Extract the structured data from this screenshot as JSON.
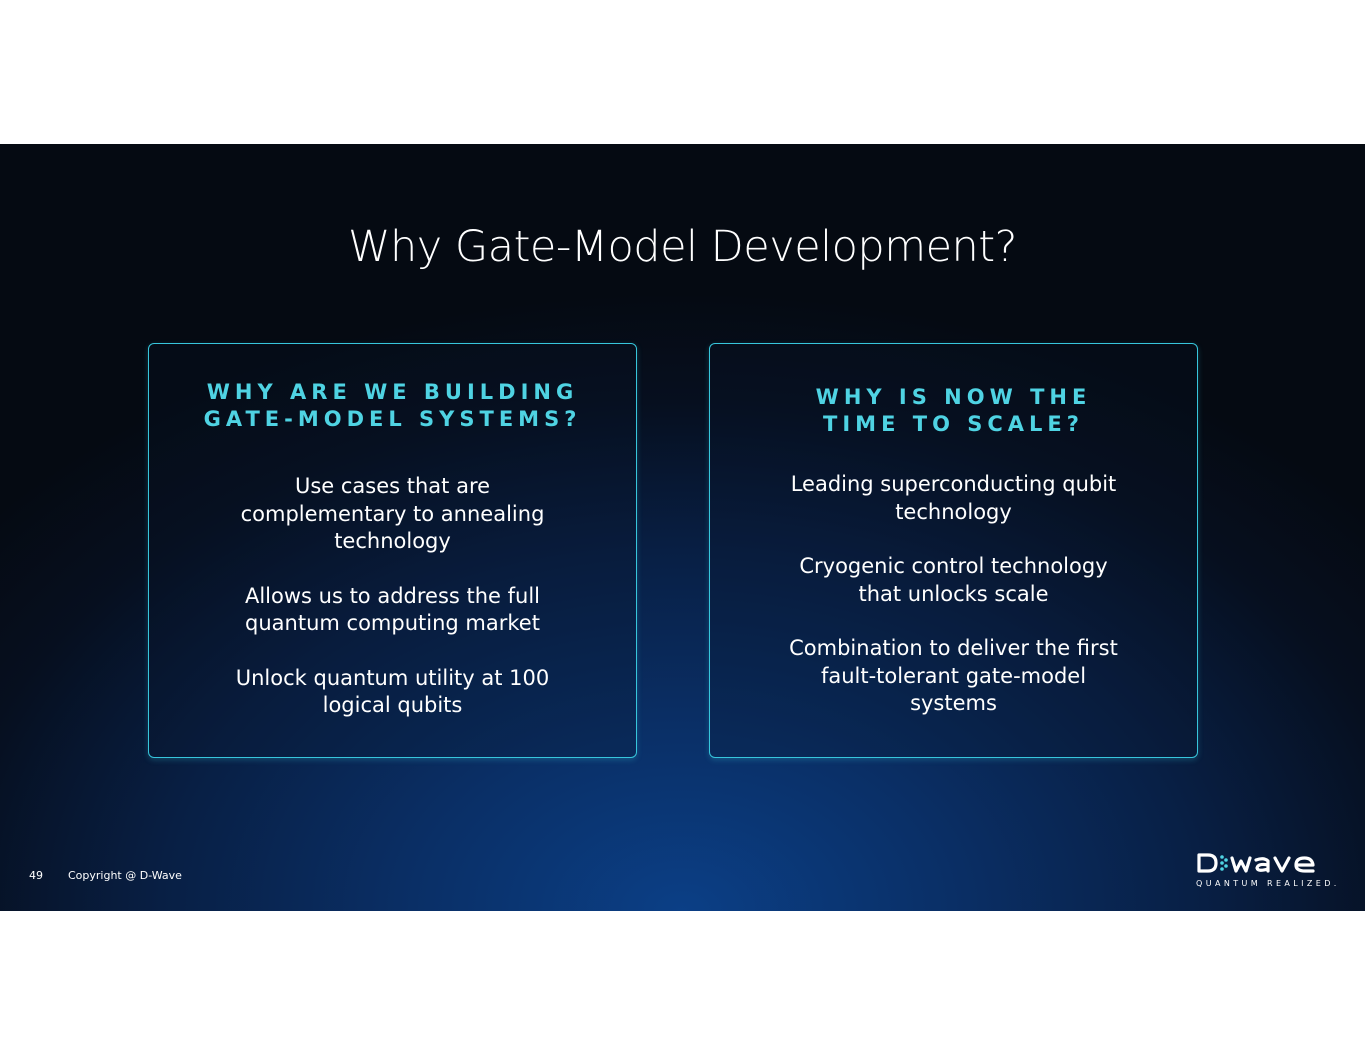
{
  "slide": {
    "title": "Why Gate-Model Development?",
    "page_number": "49",
    "copyright": "Copyright @ D-Wave"
  },
  "left_card": {
    "heading_line1": "WHY ARE WE BUILDING",
    "heading_line2": "GATE-MODEL SYSTEMS?",
    "points": [
      "Use cases that are complementary to annealing technology",
      "Allows us to address the full quantum computing market",
      "Unlock quantum utility at 100 logical qubits"
    ]
  },
  "right_card": {
    "heading_line1": "WHY IS NOW THE",
    "heading_line2": "TIME TO SCALE?",
    "points": [
      "Leading superconducting qubit technology",
      "Cryogenic control technology that unlocks scale",
      "Combination to deliver the first fault-tolerant gate-model systems"
    ]
  },
  "logo": {
    "wordmark": "D:Wave",
    "tagline": "QUANTUM REALIZED."
  },
  "colors": {
    "accent": "#4fd3e3",
    "card_border": "#37c6dc",
    "background_dark": "#050a12",
    "background_glow": "#0b3f86"
  }
}
